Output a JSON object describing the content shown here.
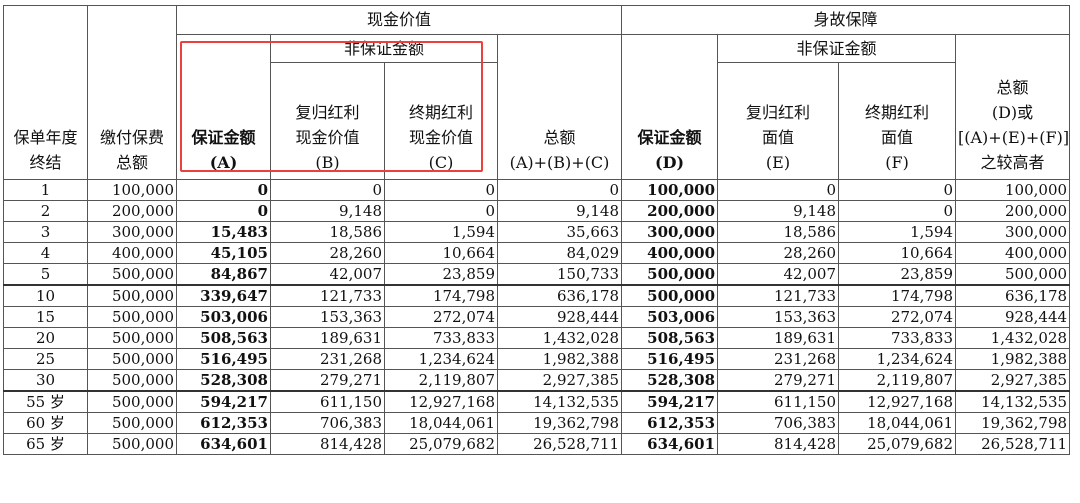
{
  "header": {
    "policy_year_line1": "保单年度",
    "policy_year_line2": "终结",
    "premium_line1": "缴付保费",
    "premium_line2": "总额",
    "cash_value_group": "现金价值",
    "death_benefit_group": "身故保障",
    "cv_non_guaranteed": "非保证金额",
    "db_non_guaranteed": "非保证金额",
    "cv_guaranteed_line1": "保证金额",
    "cv_guaranteed_line2": "(A)",
    "cv_reversionary_line1": "复归红利",
    "cv_reversionary_line2": "现金价值",
    "cv_reversionary_line3": "(B)",
    "cv_terminal_line1": "终期红利",
    "cv_terminal_line2": "现金价值",
    "cv_terminal_line3": "(C)",
    "cv_total_line1": "总额",
    "cv_total_line2": "(A)+(B)+(C)",
    "db_guaranteed_line1": "保证金额",
    "db_guaranteed_line2": "(D)",
    "db_reversionary_line1": "复归红利",
    "db_reversionary_line2": "面值",
    "db_reversionary_line3": "(E)",
    "db_terminal_line1": "终期红利",
    "db_terminal_line2": "面值",
    "db_terminal_line3": "(F)",
    "db_total_line1": "总额",
    "db_total_line2": "(D)或",
    "db_total_line3": "[(A)+(E)+(F)]",
    "db_total_line4": "之较高者"
  },
  "rows": [
    {
      "year": "1",
      "premium": "100,000",
      "a": "0",
      "b": "0",
      "c": "0",
      "abc": "0",
      "d": "100,000",
      "e": "0",
      "f": "0",
      "total": "100,000"
    },
    {
      "year": "2",
      "premium": "200,000",
      "a": "0",
      "b": "9,148",
      "c": "0",
      "abc": "9,148",
      "d": "200,000",
      "e": "9,148",
      "f": "0",
      "total": "200,000"
    },
    {
      "year": "3",
      "premium": "300,000",
      "a": "15,483",
      "b": "18,586",
      "c": "1,594",
      "abc": "35,663",
      "d": "300,000",
      "e": "18,586",
      "f": "1,594",
      "total": "300,000"
    },
    {
      "year": "4",
      "premium": "400,000",
      "a": "45,105",
      "b": "28,260",
      "c": "10,664",
      "abc": "84,029",
      "d": "400,000",
      "e": "28,260",
      "f": "10,664",
      "total": "400,000"
    },
    {
      "year": "5",
      "premium": "500,000",
      "a": "84,867",
      "b": "42,007",
      "c": "23,859",
      "abc": "150,733",
      "d": "500,000",
      "e": "42,007",
      "f": "23,859",
      "total": "500,000"
    },
    {
      "year": "10",
      "premium": "500,000",
      "a": "339,647",
      "b": "121,733",
      "c": "174,798",
      "abc": "636,178",
      "d": "500,000",
      "e": "121,733",
      "f": "174,798",
      "total": "636,178"
    },
    {
      "year": "15",
      "premium": "500,000",
      "a": "503,006",
      "b": "153,363",
      "c": "272,074",
      "abc": "928,444",
      "d": "503,006",
      "e": "153,363",
      "f": "272,074",
      "total": "928,444"
    },
    {
      "year": "20",
      "premium": "500,000",
      "a": "508,563",
      "b": "189,631",
      "c": "733,833",
      "abc": "1,432,028",
      "d": "508,563",
      "e": "189,631",
      "f": "733,833",
      "total": "1,432,028"
    },
    {
      "year": "25",
      "premium": "500,000",
      "a": "516,495",
      "b": "231,268",
      "c": "1,234,624",
      "abc": "1,982,388",
      "d": "516,495",
      "e": "231,268",
      "f": "1,234,624",
      "total": "1,982,388"
    },
    {
      "year": "30",
      "premium": "500,000",
      "a": "528,308",
      "b": "279,271",
      "c": "2,119,807",
      "abc": "2,927,385",
      "d": "528,308",
      "e": "279,271",
      "f": "2,119,807",
      "total": "2,927,385"
    },
    {
      "year": "55 岁",
      "premium": "500,000",
      "a": "594,217",
      "b": "611,150",
      "c": "12,927,168",
      "abc": "14,132,535",
      "d": "594,217",
      "e": "611,150",
      "f": "12,927,168",
      "total": "14,132,535"
    },
    {
      "year": "60 岁",
      "premium": "500,000",
      "a": "612,353",
      "b": "706,383",
      "c": "18,044,061",
      "abc": "19,362,798",
      "d": "612,353",
      "e": "706,383",
      "f": "18,044,061",
      "total": "19,362,798"
    },
    {
      "year": "65 岁",
      "premium": "500,000",
      "a": "634,601",
      "b": "814,428",
      "c": "25,079,682",
      "abc": "26,528,711",
      "d": "634,601",
      "e": "814,428",
      "f": "25,079,682",
      "total": "26,528,711"
    }
  ],
  "group_starts": [
    5,
    10
  ],
  "highlight_color": "#e8413e"
}
